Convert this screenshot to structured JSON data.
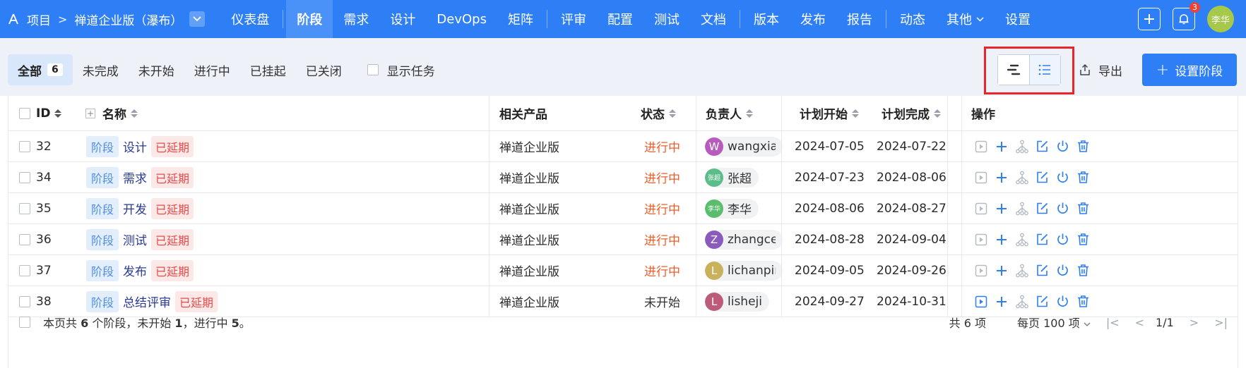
{
  "nav": {
    "project_label": "项目",
    "breadcrumb_sep": ">",
    "product_name": "禅道企业版（瀑布）",
    "menu": [
      {
        "label": "仪表盘",
        "active": false
      },
      {
        "label": "阶段",
        "active": true
      },
      {
        "label": "需求",
        "active": false
      },
      {
        "label": "设计",
        "active": false
      },
      {
        "label": "DevOps",
        "active": false
      },
      {
        "label": "矩阵",
        "active": false
      },
      {
        "label": "评审",
        "active": false
      },
      {
        "label": "配置",
        "active": false
      },
      {
        "label": "测试",
        "active": false
      },
      {
        "label": "文档",
        "active": false
      },
      {
        "label": "版本",
        "active": false
      },
      {
        "label": "发布",
        "active": false
      },
      {
        "label": "报告",
        "active": false
      },
      {
        "label": "动态",
        "active": false
      },
      {
        "label": "其他",
        "active": false
      },
      {
        "label": "设置",
        "active": false
      }
    ],
    "notification_count": "3",
    "avatar_text": "李华"
  },
  "toolbar": {
    "filters": [
      {
        "label": "全部",
        "count": "6",
        "active": true
      },
      {
        "label": "未完成",
        "active": false
      },
      {
        "label": "未开始",
        "active": false
      },
      {
        "label": "进行中",
        "active": false
      },
      {
        "label": "已挂起",
        "active": false
      },
      {
        "label": "已关闭",
        "active": false
      }
    ],
    "show_tasks_label": "显示任务",
    "export_label": "导出",
    "add_stage_label": "设置阶段"
  },
  "table": {
    "headers": {
      "id": "ID",
      "name": "名称",
      "product": "相关产品",
      "status": "状态",
      "owner": "负责人",
      "plan_start": "计划开始",
      "plan_end": "计划完成",
      "actions": "操作"
    },
    "rows": [
      {
        "id": "32",
        "tag": "阶段",
        "name": "设计",
        "delay": "已延期",
        "product": "禅道企业版",
        "status": "进行中",
        "status_type": "running",
        "owner_initial": "W",
        "owner_name": "wangxiangnan",
        "owner_color": "#b75bbd",
        "start": "2024-07-05",
        "end": "2024-07-22"
      },
      {
        "id": "34",
        "tag": "阶段",
        "name": "需求",
        "delay": "已延期",
        "product": "禅道企业版",
        "status": "进行中",
        "status_type": "running",
        "owner_initial": "张超",
        "owner_name": "张超",
        "owner_color": "#5bbd8a",
        "start": "2024-07-23",
        "end": "2024-08-06"
      },
      {
        "id": "35",
        "tag": "阶段",
        "name": "开发",
        "delay": "已延期",
        "product": "禅道企业版",
        "status": "进行中",
        "status_type": "running",
        "owner_initial": "李华",
        "owner_name": "李华",
        "owner_color": "#5bbd6e",
        "start": "2024-08-06",
        "end": "2024-08-27"
      },
      {
        "id": "36",
        "tag": "阶段",
        "name": "测试",
        "delay": "已延期",
        "product": "禅道企业版",
        "status": "进行中",
        "status_type": "running",
        "owner_initial": "Z",
        "owner_name": "zhangceshi",
        "owner_color": "#8a5bbd",
        "start": "2024-08-28",
        "end": "2024-09-04"
      },
      {
        "id": "37",
        "tag": "阶段",
        "name": "发布",
        "delay": "已延期",
        "product": "禅道企业版",
        "status": "进行中",
        "status_type": "running",
        "owner_initial": "L",
        "owner_name": "lichanpin",
        "owner_color": "#c9b25b",
        "start": "2024-09-05",
        "end": "2024-09-26"
      },
      {
        "id": "38",
        "tag": "阶段",
        "name": "总结评审",
        "delay": "已延期",
        "product": "禅道企业版",
        "status": "未开始",
        "status_type": "not_started",
        "owner_initial": "L",
        "owner_name": "lisheji",
        "owner_color": "#bd5b7a",
        "start": "2024-09-27",
        "end": "2024-10-31"
      }
    ],
    "footer": {
      "summary_prefix": "本页共 ",
      "total": "6",
      "summary_mid1": " 个阶段，未开始 ",
      "not_started": "1",
      "summary_mid2": "，进行中 ",
      "running": "5",
      "summary_end": "。",
      "total_items": "共 6 项",
      "per_page": "每页 100 项",
      "page": "1/1"
    }
  }
}
